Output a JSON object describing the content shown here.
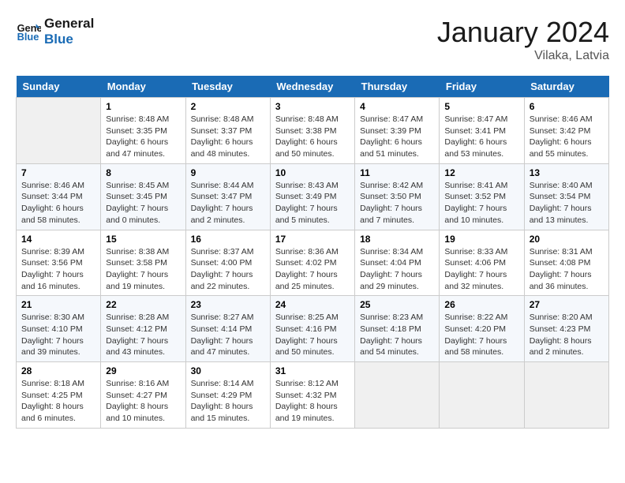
{
  "header": {
    "logo_line1": "General",
    "logo_line2": "Blue",
    "month": "January 2024",
    "location": "Vilaka, Latvia"
  },
  "weekdays": [
    "Sunday",
    "Monday",
    "Tuesday",
    "Wednesday",
    "Thursday",
    "Friday",
    "Saturday"
  ],
  "weeks": [
    [
      {
        "day": "",
        "info": ""
      },
      {
        "day": "1",
        "info": "Sunrise: 8:48 AM\nSunset: 3:35 PM\nDaylight: 6 hours\nand 47 minutes."
      },
      {
        "day": "2",
        "info": "Sunrise: 8:48 AM\nSunset: 3:37 PM\nDaylight: 6 hours\nand 48 minutes."
      },
      {
        "day": "3",
        "info": "Sunrise: 8:48 AM\nSunset: 3:38 PM\nDaylight: 6 hours\nand 50 minutes."
      },
      {
        "day": "4",
        "info": "Sunrise: 8:47 AM\nSunset: 3:39 PM\nDaylight: 6 hours\nand 51 minutes."
      },
      {
        "day": "5",
        "info": "Sunrise: 8:47 AM\nSunset: 3:41 PM\nDaylight: 6 hours\nand 53 minutes."
      },
      {
        "day": "6",
        "info": "Sunrise: 8:46 AM\nSunset: 3:42 PM\nDaylight: 6 hours\nand 55 minutes."
      }
    ],
    [
      {
        "day": "7",
        "info": "Sunrise: 8:46 AM\nSunset: 3:44 PM\nDaylight: 6 hours\nand 58 minutes."
      },
      {
        "day": "8",
        "info": "Sunrise: 8:45 AM\nSunset: 3:45 PM\nDaylight: 7 hours\nand 0 minutes."
      },
      {
        "day": "9",
        "info": "Sunrise: 8:44 AM\nSunset: 3:47 PM\nDaylight: 7 hours\nand 2 minutes."
      },
      {
        "day": "10",
        "info": "Sunrise: 8:43 AM\nSunset: 3:49 PM\nDaylight: 7 hours\nand 5 minutes."
      },
      {
        "day": "11",
        "info": "Sunrise: 8:42 AM\nSunset: 3:50 PM\nDaylight: 7 hours\nand 7 minutes."
      },
      {
        "day": "12",
        "info": "Sunrise: 8:41 AM\nSunset: 3:52 PM\nDaylight: 7 hours\nand 10 minutes."
      },
      {
        "day": "13",
        "info": "Sunrise: 8:40 AM\nSunset: 3:54 PM\nDaylight: 7 hours\nand 13 minutes."
      }
    ],
    [
      {
        "day": "14",
        "info": "Sunrise: 8:39 AM\nSunset: 3:56 PM\nDaylight: 7 hours\nand 16 minutes."
      },
      {
        "day": "15",
        "info": "Sunrise: 8:38 AM\nSunset: 3:58 PM\nDaylight: 7 hours\nand 19 minutes."
      },
      {
        "day": "16",
        "info": "Sunrise: 8:37 AM\nSunset: 4:00 PM\nDaylight: 7 hours\nand 22 minutes."
      },
      {
        "day": "17",
        "info": "Sunrise: 8:36 AM\nSunset: 4:02 PM\nDaylight: 7 hours\nand 25 minutes."
      },
      {
        "day": "18",
        "info": "Sunrise: 8:34 AM\nSunset: 4:04 PM\nDaylight: 7 hours\nand 29 minutes."
      },
      {
        "day": "19",
        "info": "Sunrise: 8:33 AM\nSunset: 4:06 PM\nDaylight: 7 hours\nand 32 minutes."
      },
      {
        "day": "20",
        "info": "Sunrise: 8:31 AM\nSunset: 4:08 PM\nDaylight: 7 hours\nand 36 minutes."
      }
    ],
    [
      {
        "day": "21",
        "info": "Sunrise: 8:30 AM\nSunset: 4:10 PM\nDaylight: 7 hours\nand 39 minutes."
      },
      {
        "day": "22",
        "info": "Sunrise: 8:28 AM\nSunset: 4:12 PM\nDaylight: 7 hours\nand 43 minutes."
      },
      {
        "day": "23",
        "info": "Sunrise: 8:27 AM\nSunset: 4:14 PM\nDaylight: 7 hours\nand 47 minutes."
      },
      {
        "day": "24",
        "info": "Sunrise: 8:25 AM\nSunset: 4:16 PM\nDaylight: 7 hours\nand 50 minutes."
      },
      {
        "day": "25",
        "info": "Sunrise: 8:23 AM\nSunset: 4:18 PM\nDaylight: 7 hours\nand 54 minutes."
      },
      {
        "day": "26",
        "info": "Sunrise: 8:22 AM\nSunset: 4:20 PM\nDaylight: 7 hours\nand 58 minutes."
      },
      {
        "day": "27",
        "info": "Sunrise: 8:20 AM\nSunset: 4:23 PM\nDaylight: 8 hours\nand 2 minutes."
      }
    ],
    [
      {
        "day": "28",
        "info": "Sunrise: 8:18 AM\nSunset: 4:25 PM\nDaylight: 8 hours\nand 6 minutes."
      },
      {
        "day": "29",
        "info": "Sunrise: 8:16 AM\nSunset: 4:27 PM\nDaylight: 8 hours\nand 10 minutes."
      },
      {
        "day": "30",
        "info": "Sunrise: 8:14 AM\nSunset: 4:29 PM\nDaylight: 8 hours\nand 15 minutes."
      },
      {
        "day": "31",
        "info": "Sunrise: 8:12 AM\nSunset: 4:32 PM\nDaylight: 8 hours\nand 19 minutes."
      },
      {
        "day": "",
        "info": ""
      },
      {
        "day": "",
        "info": ""
      },
      {
        "day": "",
        "info": ""
      }
    ]
  ]
}
